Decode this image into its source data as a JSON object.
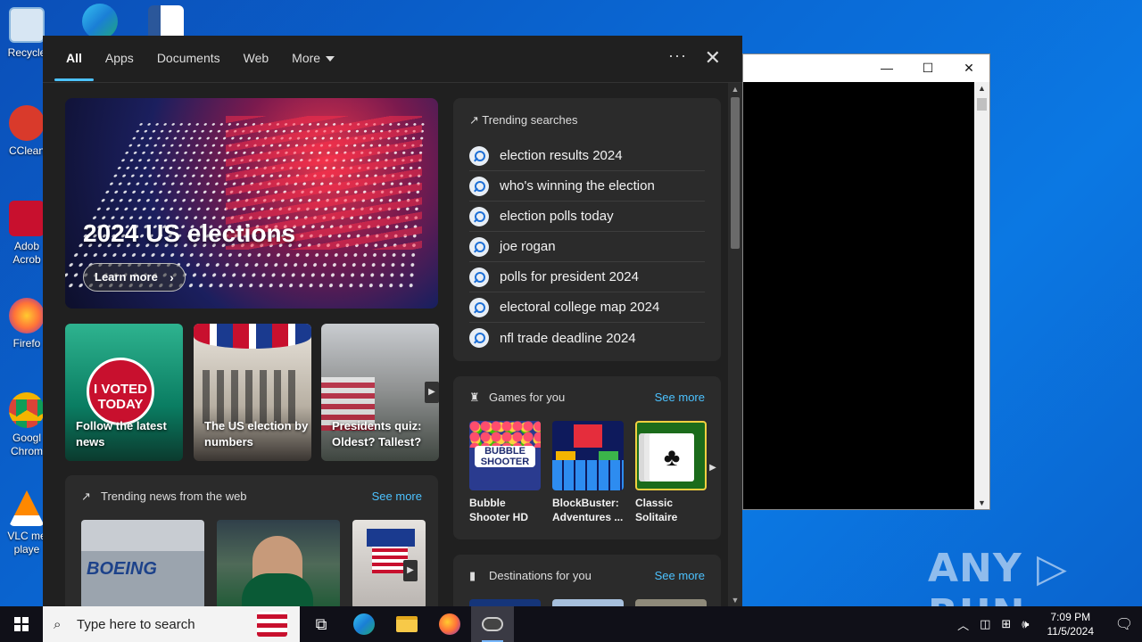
{
  "desktop": {
    "icons": [
      {
        "label": "Recycle",
        "color": "#5aa9e6"
      },
      {
        "label": "CClean",
        "color": "#d93a2b"
      },
      {
        "label": "Adob Acrob",
        "color": "#c8102e"
      },
      {
        "label": "Firefo",
        "color": "#ff7139"
      },
      {
        "label": "Googl Chrom",
        "color": "#4285f4"
      },
      {
        "label": "VLC me playe",
        "color": "#ff8800"
      }
    ]
  },
  "background_window": {
    "controls": {
      "minimize": "—",
      "maximize": "☐",
      "close": "✕"
    }
  },
  "watermark": "ANY ▷ RUN",
  "search_panel": {
    "tabs": [
      {
        "label": "All",
        "active": true
      },
      {
        "label": "Apps"
      },
      {
        "label": "Documents"
      },
      {
        "label": "Web"
      },
      {
        "label": "More"
      }
    ],
    "more_options": "···",
    "close": "✕",
    "hero": {
      "title": "2024 US elections",
      "button": "Learn more"
    },
    "cards": [
      {
        "label": "Follow the latest news",
        "sticker": "I VOTED TODAY"
      },
      {
        "label": "The US election by numbers"
      },
      {
        "label": "Presidents quiz: Oldest? Tallest?"
      }
    ],
    "trending_news": {
      "title": "Trending news from the web",
      "see_more": "See more",
      "thumb_logo": "BOEING"
    },
    "trending_searches": {
      "title": "Trending searches",
      "items": [
        "election results 2024",
        "who's winning the election",
        "election polls today",
        "joe rogan",
        "polls for president 2024",
        "electoral college map 2024",
        "nfl trade deadline 2024"
      ]
    },
    "games": {
      "title": "Games for you",
      "see_more": "See more",
      "items": [
        {
          "name": "Bubble Shooter HD",
          "art_text": "BUBBLE SHOOTER"
        },
        {
          "name": "BlockBuster: Adventures ..."
        },
        {
          "name": "Classic Solitaire"
        }
      ]
    },
    "destinations": {
      "title": "Destinations for you",
      "see_more": "See more"
    }
  },
  "taskbar": {
    "search_placeholder": "Type here to search",
    "time": "7:09 PM",
    "date": "11/5/2024"
  },
  "colors": {
    "accent": "#4cc2ff",
    "panel_bg": "#202020",
    "card_bg": "#2b2b2b",
    "taskbar_bg": "#101018"
  }
}
